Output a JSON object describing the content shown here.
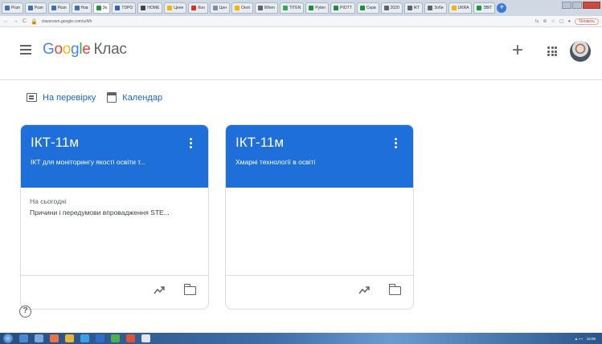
{
  "browser": {
    "tabs": [
      {
        "label": "Розп",
        "color": "#3e6fb6"
      },
      {
        "label": "Розп",
        "color": "#3e6fb6"
      },
      {
        "label": "Розп",
        "color": "#3e6fb6"
      },
      {
        "label": "Нов",
        "color": "#3e6fb6"
      },
      {
        "label": "Зе",
        "color": "#2a8f3c",
        "active": true
      },
      {
        "label": "TDPO",
        "color": "#3062b8"
      },
      {
        "label": "HOME",
        "color": "#444444"
      },
      {
        "label": "Цене",
        "color": "#f4b400"
      },
      {
        "label": "Кон",
        "color": "#d93025"
      },
      {
        "label": "Цен",
        "color": "#7b8fa6"
      },
      {
        "label": "Онлі",
        "color": "#f4b400"
      },
      {
        "label": "When",
        "color": "#5f6368"
      },
      {
        "label": "TITEN",
        "color": "#34a853"
      },
      {
        "label": "Pyten",
        "color": "#1e8e3e"
      },
      {
        "label": "PIOTT",
        "color": "#1e8e3e"
      },
      {
        "label": "Серв",
        "color": "#1e8e3e"
      },
      {
        "label": "2020",
        "color": "#5f6368"
      },
      {
        "label": "ІКТ",
        "color": "#5f6368"
      },
      {
        "label": "Зоби",
        "color": "#5f6368"
      },
      {
        "label": "UKRA",
        "color": "#f4b400"
      },
      {
        "label": "ЗВІТ",
        "color": "#2a8f3c"
      }
    ],
    "url": "classroom.google.com/u/4/h",
    "update_label": "Оновить"
  },
  "header": {
    "logo": {
      "g": "G",
      "o1": "o",
      "o2": "o",
      "g2": "g",
      "l": "l",
      "e": "e"
    },
    "product": "Клас"
  },
  "subnav": {
    "todo_label": "На перевірку",
    "calendar_label": "Календар"
  },
  "cards": [
    {
      "title": "ІКТ-11м",
      "subtitle": "ІКТ для моніторингу якості освіти т...",
      "due_label": "На сьогодні",
      "due_item": "Причини і передумови впровадження STE..."
    },
    {
      "title": "ІКТ-11м",
      "subtitle": "Хмарні технології в освіті",
      "due_label": "",
      "due_item": ""
    }
  ],
  "colors": {
    "card_header": "#1e6fd9",
    "link_blue": "#1967d2",
    "icon_grey": "#5f6368"
  },
  "taskbar": {
    "tray_time": "18:05"
  }
}
